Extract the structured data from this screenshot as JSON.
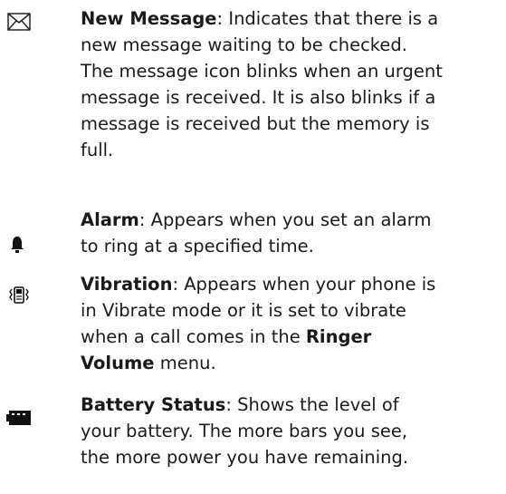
{
  "entries": [
    {
      "icon": "envelope-icon",
      "title": "New Message",
      "lines": [
        ": Indicates that there is a",
        "new message waiting to be checked.",
        "The message icon blinks when an urgent",
        "message is received. It is also blinks if a",
        "message is received but the memory is",
        "full."
      ]
    },
    {
      "icon": "bell-icon",
      "title": "Alarm",
      "lines": [
        ": Appears when you set an alarm",
        "to ring at a specified time."
      ]
    },
    {
      "icon": "vibrate-icon",
      "title": "Vibration",
      "lines": [
        ": Appears when your phone is",
        "in Vibrate mode or it is set to vibrate",
        "when a call comes in the "
      ],
      "bold_ref_1": "Ringer",
      "bold_ref_2": "Volume",
      "tail": " menu."
    },
    {
      "icon": "battery-icon",
      "title": "Battery Status",
      "lines": [
        ": Shows the level of",
        "your battery. The more bars you see,",
        "the more power you have remaining."
      ]
    }
  ]
}
